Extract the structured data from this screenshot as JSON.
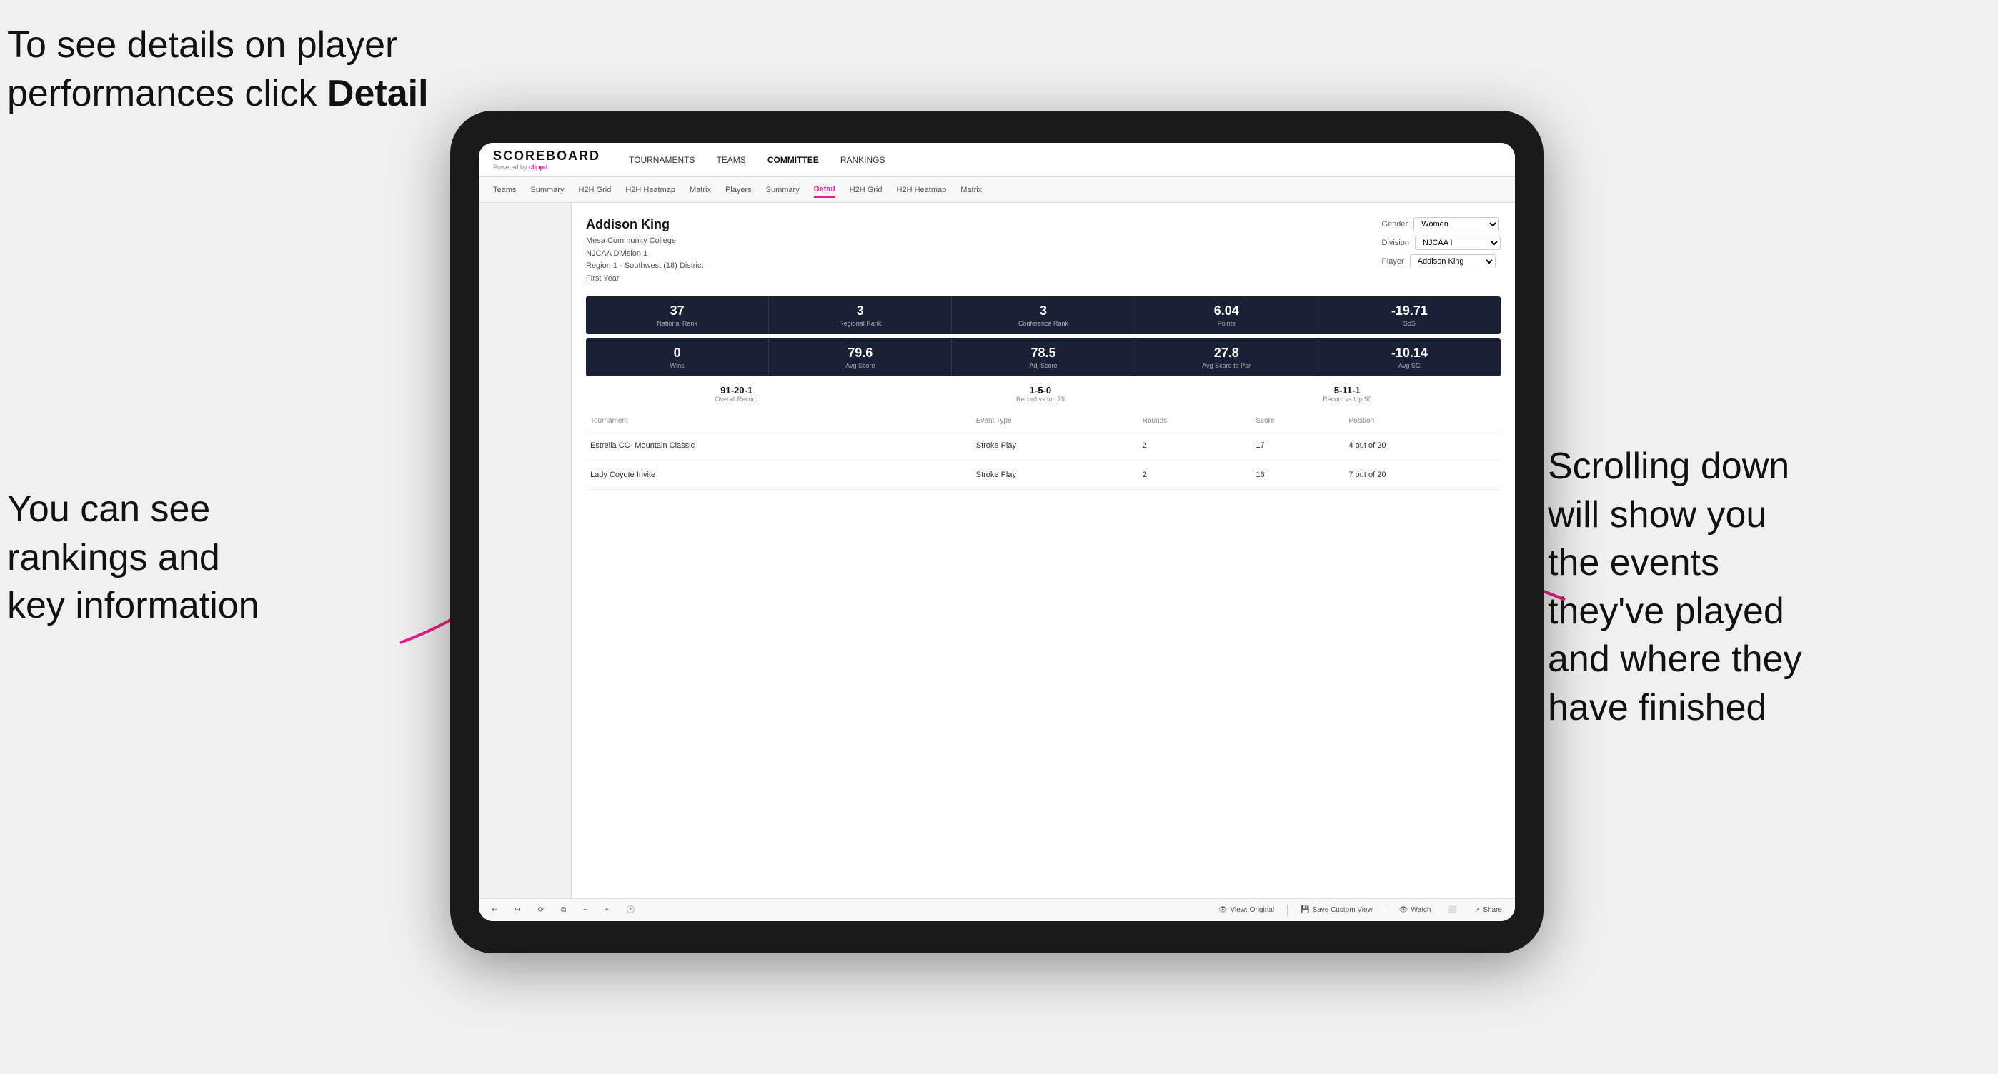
{
  "annotations": {
    "top_left": "To see details on player performances click ",
    "top_left_bold": "Detail",
    "bottom_left_line1": "You can see",
    "bottom_left_line2": "rankings and",
    "bottom_left_line3": "key information",
    "right_line1": "Scrolling down",
    "right_line2": "will show you",
    "right_line3": "the events",
    "right_line4": "they've played",
    "right_line5": "and where they",
    "right_line6": "have finished"
  },
  "nav": {
    "logo": "SCOREBOARD",
    "powered_by": "Powered by ",
    "powered_brand": "clippd",
    "items": [
      "TOURNAMENTS",
      "TEAMS",
      "COMMITTEE",
      "RANKINGS"
    ]
  },
  "subnav": {
    "items": [
      "Teams",
      "Summary",
      "H2H Grid",
      "H2H Heatmap",
      "Matrix",
      "Players",
      "Summary",
      "Detail",
      "H2H Grid",
      "H2H Heatmap",
      "Matrix"
    ],
    "active": "Detail"
  },
  "player": {
    "name": "Addison King",
    "college": "Mesa Community College",
    "division": "NJCAA Division 1",
    "region": "Region 1 - Southwest (18) District",
    "year": "First Year"
  },
  "selectors": {
    "gender_label": "Gender",
    "gender_value": "Women",
    "division_label": "Division",
    "division_value": "NJCAA I",
    "player_label": "Player",
    "player_value": "Addison King"
  },
  "stats_row1": [
    {
      "value": "37",
      "label": "National Rank"
    },
    {
      "value": "3",
      "label": "Regional Rank"
    },
    {
      "value": "3",
      "label": "Conference Rank"
    },
    {
      "value": "6.04",
      "label": "Points"
    },
    {
      "value": "-19.71",
      "label": "SoS"
    }
  ],
  "stats_row2": [
    {
      "value": "0",
      "label": "Wins"
    },
    {
      "value": "79.6",
      "label": "Avg Score"
    },
    {
      "value": "78.5",
      "label": "Adj Score"
    },
    {
      "value": "27.8",
      "label": "Avg Score to Par"
    },
    {
      "value": "-10.14",
      "label": "Avg SG"
    }
  ],
  "records": [
    {
      "value": "91-20-1",
      "label": "Overall Record"
    },
    {
      "value": "1-5-0",
      "label": "Record vs top 25"
    },
    {
      "value": "5-11-1",
      "label": "Record vs top 50"
    }
  ],
  "table": {
    "columns": [
      "Tournament",
      "Event Type",
      "Rounds",
      "Score",
      "Position"
    ],
    "rows": [
      {
        "tournament": "Estrella CC- Mountain Classic",
        "event_type": "Stroke Play",
        "rounds": "2",
        "score": "17",
        "position": "4 out of 20"
      },
      {
        "tournament": "Lady Coyote Invite",
        "event_type": "Stroke Play",
        "rounds": "2",
        "score": "16",
        "position": "7 out of 20"
      }
    ]
  },
  "toolbar": {
    "view_label": "View: Original",
    "save_label": "Save Custom View",
    "watch_label": "Watch",
    "share_label": "Share"
  }
}
